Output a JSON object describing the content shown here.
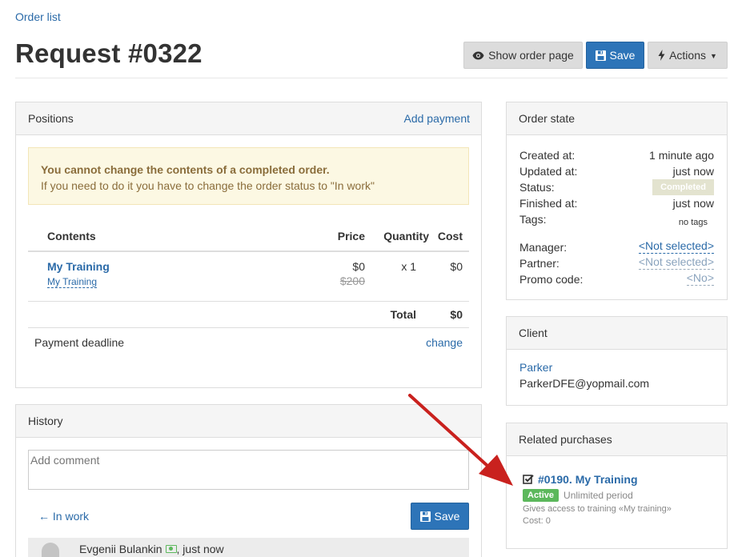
{
  "breadcrumb": {
    "order_list": "Order list"
  },
  "page": {
    "title": "Request #0322"
  },
  "toolbar": {
    "show_order_page": "Show order page",
    "save": "Save",
    "actions": "Actions"
  },
  "positions": {
    "title": "Positions",
    "add_payment": "Add payment",
    "alert": {
      "title": "You cannot change the contents of a completed order.",
      "text": "If you need to do it you have to change the order status to \"In work\""
    },
    "table": {
      "headers": {
        "contents": "Contents",
        "price": "Price",
        "quantity": "Quantity",
        "cost": "Cost"
      },
      "rows": [
        {
          "name": "My Training",
          "sub": "My Training",
          "price": "$0",
          "old_price": "$200",
          "quantity": "x 1",
          "cost": "$0"
        }
      ],
      "total_label": "Total",
      "total_value": "$0"
    },
    "payment_deadline": {
      "label": "Payment deadline",
      "action": "change"
    }
  },
  "history": {
    "title": "History",
    "comment_placeholder": "Add comment",
    "back_status": "In work",
    "save": "Save",
    "entry": {
      "author": "Evgenii Bulankin",
      "time": ", just now"
    }
  },
  "order_state": {
    "title": "Order state",
    "created_label": "Created at:",
    "created_value": "1 minute ago",
    "updated_label": "Updated at:",
    "updated_value": "just now",
    "status_label": "Status:",
    "status_value": "Completed",
    "finished_label": "Finished at:",
    "finished_value": "just now",
    "tags_label": "Tags:",
    "tags_value": "no tags",
    "manager_label": "Manager:",
    "manager_value": "<Not selected>",
    "partner_label": "Partner:",
    "partner_value": "<Not selected>",
    "promo_label": "Promo code:",
    "promo_value": "<No>"
  },
  "client": {
    "title": "Client",
    "name": "Parker",
    "email": "ParkerDFE@yopmail.com"
  },
  "related": {
    "title": "Related purchases",
    "item": {
      "title": "#0190. My Training",
      "status": "Active",
      "period": "Unlimited period",
      "access": "Gives access to training «My training»",
      "cost": "Cost: 0"
    }
  },
  "colors": {
    "accent": "#2d74b8",
    "active_green": "#5cb85c",
    "alert_bg": "#fcf8e3",
    "arrow_red": "#c9211e"
  }
}
